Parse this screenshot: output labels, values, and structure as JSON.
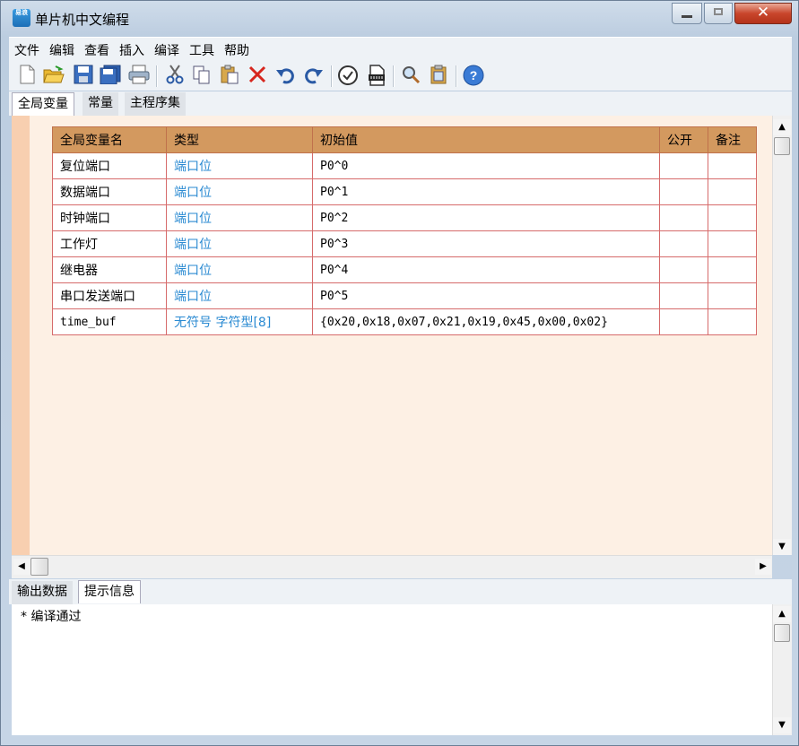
{
  "window": {
    "title": "单片机中文编程",
    "icon_text": "易浪"
  },
  "menu": [
    "文件",
    "编辑",
    "查看",
    "插入",
    "编译",
    "工具",
    "帮助"
  ],
  "toolbar_icons": [
    "new-file-icon",
    "open-folder-icon",
    "save-icon",
    "save-all-icon",
    "print-icon",
    "cut-icon",
    "copy-icon",
    "paste-icon",
    "delete-icon",
    "undo-icon",
    "redo-icon",
    "check-compile-icon",
    "download-chip-icon",
    "search-icon",
    "clipboard-icon",
    "help-icon"
  ],
  "top_tabs": {
    "active": "全局变量",
    "items": [
      "全局变量",
      "常量",
      "主程序集"
    ]
  },
  "table": {
    "headers": [
      "全局变量名",
      "类型",
      "初始值",
      "公开",
      "备注"
    ],
    "rows": [
      [
        "复位端口",
        "端口位",
        "P0^0",
        "",
        ""
      ],
      [
        "数据端口",
        "端口位",
        "P0^1",
        "",
        ""
      ],
      [
        "时钟端口",
        "端口位",
        "P0^2",
        "",
        ""
      ],
      [
        "工作灯",
        "端口位",
        "P0^3",
        "",
        ""
      ],
      [
        "继电器",
        "端口位",
        "P0^4",
        "",
        ""
      ],
      [
        "串口发送端口",
        "端口位",
        "P0^5",
        "",
        ""
      ],
      [
        "time_buf",
        "无符号 字符型[8]",
        "{0x20,0x18,0x07,0x21,0x19,0x45,0x00,0x02}",
        "",
        ""
      ]
    ]
  },
  "bottom_tabs": {
    "active": "提示信息",
    "items": [
      "输出数据",
      "提示信息"
    ]
  },
  "output": {
    "lines": [
      "* 编译通过"
    ]
  },
  "colors": {
    "header_bg": "#d3995f",
    "type_text": "#2a8ad2",
    "content_bg": "#fdf0e4",
    "row_border": "#d66b6b"
  }
}
